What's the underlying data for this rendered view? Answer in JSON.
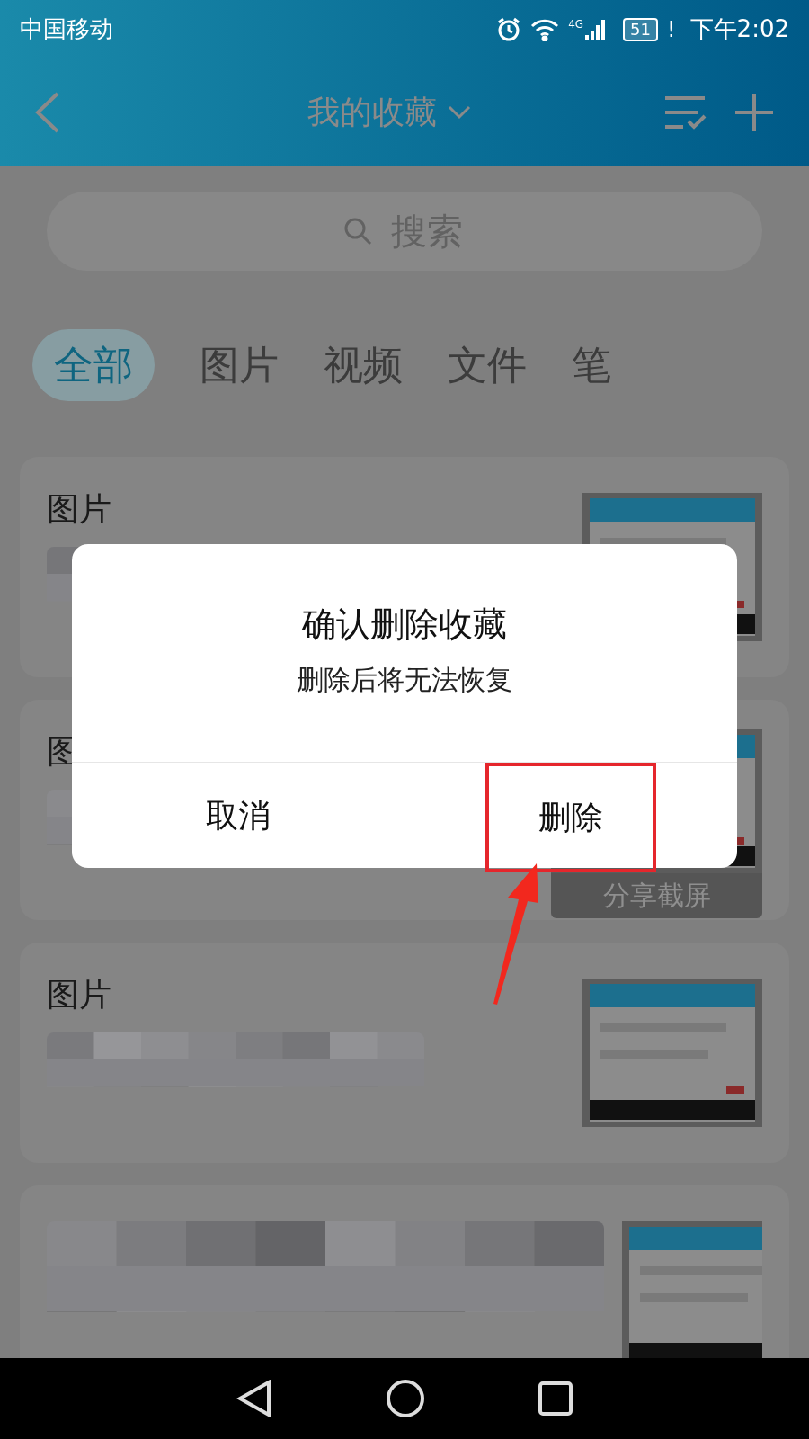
{
  "status_bar": {
    "carrier": "中国移动",
    "network": "4G",
    "battery": "51",
    "alert": "!",
    "time": "下午2:02"
  },
  "header": {
    "title": "我的收藏"
  },
  "search": {
    "placeholder": "搜索"
  },
  "tabs": [
    {
      "label": "全部",
      "selected": true
    },
    {
      "label": "图片",
      "selected": false
    },
    {
      "label": "视频",
      "selected": false
    },
    {
      "label": "文件",
      "selected": false
    },
    {
      "label": "笔",
      "selected": false
    }
  ],
  "cards": [
    {
      "kind": "titled",
      "title": "图片"
    },
    {
      "kind": "titled",
      "title": "图",
      "thumbnail_caption": "分享截屏"
    },
    {
      "kind": "titled",
      "title": "图片"
    },
    {
      "kind": "untitled"
    }
  ],
  "dialog": {
    "title": "确认删除收藏",
    "message": "删除后将无法恢复",
    "buttons": [
      {
        "label": "取消",
        "highlighted": false
      },
      {
        "label": "删除",
        "highlighted": true
      }
    ]
  }
}
